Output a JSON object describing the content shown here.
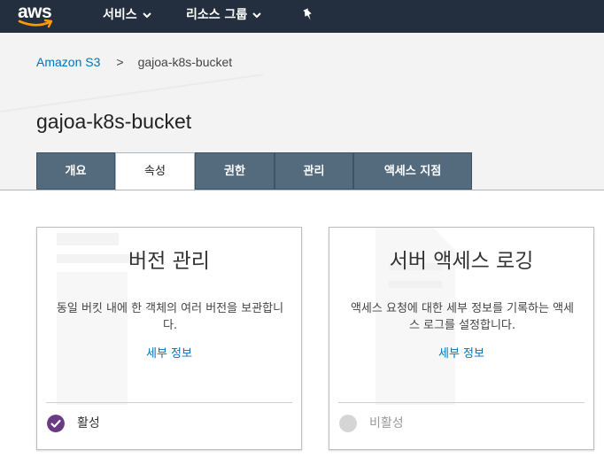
{
  "brand": {
    "logo_text": "aws"
  },
  "topnav": {
    "services_label": "서비스",
    "resource_groups_label": "리소스 그룹"
  },
  "breadcrumb": {
    "parent": "Amazon S3",
    "separator": ">",
    "current": "gajoa-k8s-bucket"
  },
  "page_title": "gajoa-k8s-bucket",
  "tabs": [
    {
      "label": "개요",
      "active": false
    },
    {
      "label": "속성",
      "active": true
    },
    {
      "label": "권한",
      "active": false
    },
    {
      "label": "관리",
      "active": false
    },
    {
      "label": "액세스 지점",
      "active": false
    }
  ],
  "cards": [
    {
      "title": "버전 관리",
      "description": "동일 버킷 내에 한 객체의 여러 버전을 보관합니다.",
      "link": "세부 정보",
      "status": "활성",
      "status_enabled": true
    },
    {
      "title": "서버 액세스 로깅",
      "description": "액세스 요청에 대한 세부 정보를 기록하는 액세스 로그를 설정합니다.",
      "link": "세부 정보",
      "status": "비활성",
      "status_enabled": false
    }
  ],
  "colors": {
    "topbar": "#232f3e",
    "aws_orange": "#ff9900",
    "tab_bg": "#546b7d",
    "link": "#0073bb",
    "status_enabled": "#6b3a85",
    "status_disabled": "#d5d5d5"
  }
}
